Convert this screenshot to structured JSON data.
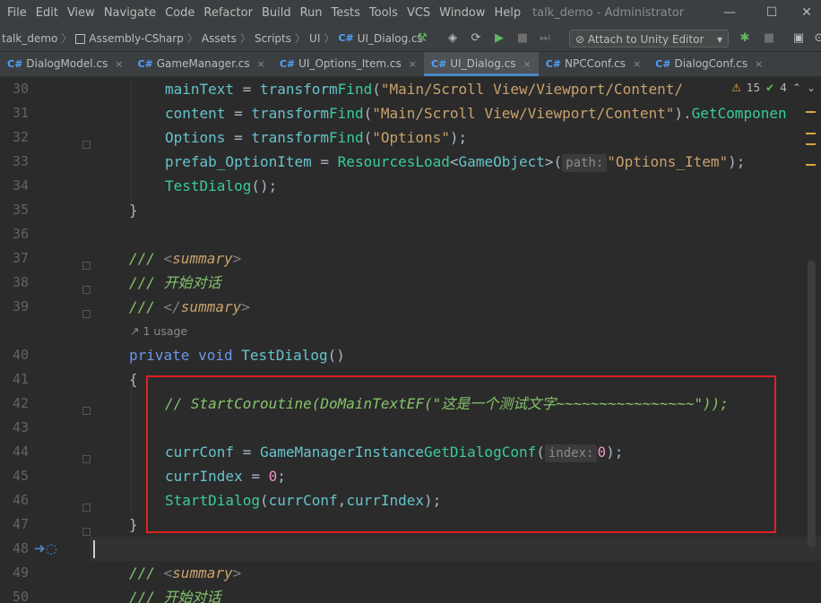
{
  "menu": [
    "File",
    "Edit",
    "View",
    "Navigate",
    "Code",
    "Refactor",
    "Build",
    "Run",
    "Tests",
    "Tools",
    "VCS",
    "Window",
    "Help"
  ],
  "window_title": "talk_demo - Administrator",
  "window_controls": {
    "minimize": "—",
    "maximize": "☐",
    "close": "✕"
  },
  "breadcrumb": {
    "project": "talk_demo",
    "assembly": "Assembly-CSharp",
    "items": [
      "Assets",
      "Scripts",
      "UI"
    ],
    "file": "UI_Dialog.cs",
    "cs_badge": "C#"
  },
  "toolbar": {
    "attach_label": "Attach to Unity Editor"
  },
  "tabs": [
    {
      "label": "DialogModel.cs",
      "active": false,
      "closable": true
    },
    {
      "label": "GameManager.cs",
      "active": false,
      "closable": true
    },
    {
      "label": "UI_Options_Item.cs",
      "active": false,
      "closable": true
    },
    {
      "label": "UI_Dialog.cs",
      "active": true,
      "closable": true
    },
    {
      "label": "NPCConf.cs",
      "active": false,
      "closable": true
    },
    {
      "label": "DialogConf.cs",
      "active": false,
      "closable": true
    }
  ],
  "tab_badge": "C#",
  "tab_close": "×",
  "inspections": {
    "warnings": "15",
    "ok": "4"
  },
  "line_numbers": [
    "30",
    "31",
    "32",
    "33",
    "34",
    "35",
    "36",
    "37",
    "38",
    "39",
    "40",
    "41",
    "42",
    "43",
    "44",
    "45",
    "46",
    "47",
    "48",
    "49",
    "50"
  ],
  "usage_hint": "1 usage",
  "code": {
    "l30": {
      "a": "mainText",
      "b": " = ",
      "c": "transform",
      ".": ".",
      "d": "Find",
      "e": "(",
      "f": "\"Main/Scroll View/Viewport/Content/"
    },
    "l31": {
      "a": "content",
      "b": " = ",
      "c": "transform",
      ".": ".",
      "d": "Find",
      "e": "(",
      "f": "\"Main/Scroll View/Viewport/Content\"",
      "g": ").",
      "h": "GetComponen"
    },
    "l32": {
      "a": "Options",
      "b": " = ",
      "c": "transform",
      ".": ".",
      "d": "Find",
      "e": "(",
      "f": "\"Options\"",
      "g": ");"
    },
    "l33": {
      "a": "prefab_OptionItem",
      "b": " = ",
      "c": "Resources",
      ".": ".",
      "d": "Load",
      "e": "<",
      "t": "GameObject",
      "e2": ">(",
      "hint": "path:",
      "f": "\"Options_Item\"",
      "g": ");"
    },
    "l34": {
      "a": "TestDialog",
      "b": "();"
    },
    "l35": "}",
    "l37": {
      "p": "/// ",
      "lt": "<",
      "tag": "summary",
      "gt": ">"
    },
    "l38": {
      "p": "/// ",
      "txt": "开始对话"
    },
    "l39": {
      "p": "/// ",
      "lt": "</",
      "tag": "summary",
      "gt": ">"
    },
    "l40": {
      "k1": "private",
      "k2": "void",
      "m": "TestDialog",
      "r": "()"
    },
    "l41": "{",
    "l42": "// StartCoroutine(DoMainTextEF(\"这是一个测试文字~~~~~~~~~~~~~~~~\"));",
    "l44": {
      "a": "currConf",
      "b": " = ",
      "c": "GameManager",
      ".": ".",
      "d": "Instance",
      ".2": ".",
      "e": "GetDialogConf",
      "f": "(",
      "hint": "index:",
      "n": "0",
      "g": ");"
    },
    "l45": {
      "a": "currIndex",
      "b": " = ",
      "n": "0",
      "g": ";"
    },
    "l46": {
      "a": "StartDialog",
      "b": "(",
      "c": "currConf",
      "d": ",",
      "e": "currIndex",
      "g": ");"
    },
    "l47": "}",
    "l49": {
      "p": "/// ",
      "lt": "<",
      "tag": "summary",
      "gt": ">"
    },
    "l50": {
      "p": "/// ",
      "txt": "开始对话"
    }
  }
}
